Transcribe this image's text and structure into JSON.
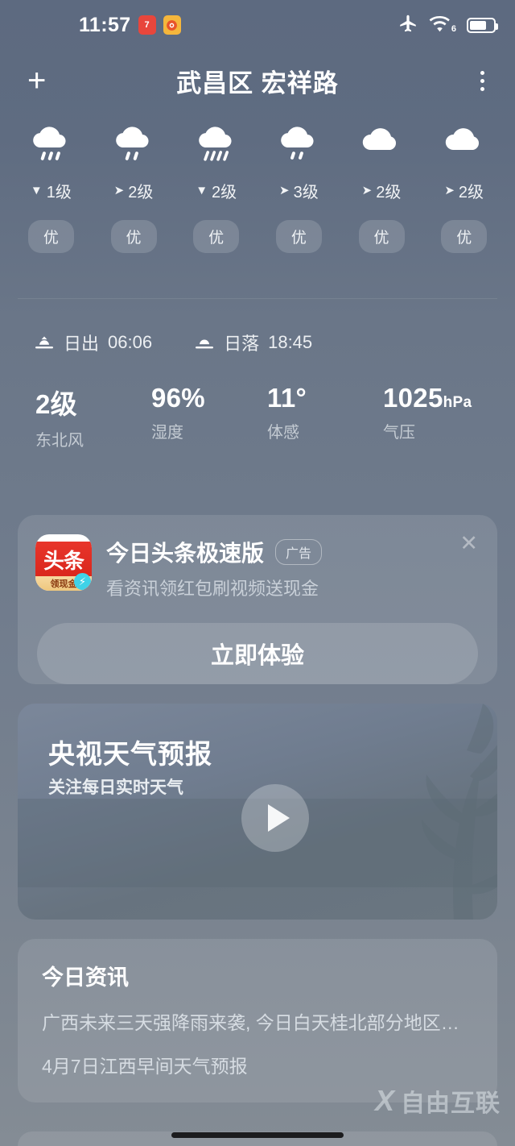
{
  "status_bar": {
    "time": "11:57",
    "badges": [
      {
        "name": "notification-badge-red",
        "glyph": "7"
      },
      {
        "name": "weibo-badge",
        "glyph": "◉"
      }
    ],
    "airplane_icon": "airplane-mode-icon",
    "wifi_icon": "wifi-icon",
    "wifi_generation": "6",
    "battery_icon": "battery-icon"
  },
  "header": {
    "add_label": "+",
    "title": "武昌区 宏祥路",
    "menu_label": "more-options"
  },
  "hourly": [
    {
      "icon": "rain-cloud-icon",
      "wind_dir": "▼",
      "wind": "1级",
      "aqi": "优"
    },
    {
      "icon": "rain-cloud-icon",
      "wind_dir": "➤",
      "wind": "2级",
      "aqi": "优"
    },
    {
      "icon": "heavy-rain-cloud-icon",
      "wind_dir": "▼",
      "wind": "2级",
      "aqi": "优"
    },
    {
      "icon": "rain-cloud-icon",
      "wind_dir": "➤",
      "wind": "3级",
      "aqi": "优"
    },
    {
      "icon": "cloud-icon",
      "wind_dir": "➤",
      "wind": "2级",
      "aqi": "优"
    },
    {
      "icon": "cloud-icon",
      "wind_dir": "➤",
      "wind": "2级",
      "aqi": "优"
    }
  ],
  "sun": {
    "sunrise_label": "日出",
    "sunrise_time": "06:06",
    "sunset_label": "日落",
    "sunset_time": "18:45"
  },
  "metrics": [
    {
      "value": "2级",
      "unit": "",
      "label": "东北风"
    },
    {
      "value": "96%",
      "unit": "",
      "label": "湿度"
    },
    {
      "value": "11°",
      "unit": "",
      "label": "体感"
    },
    {
      "value": "1025",
      "unit": "hPa",
      "label": "气压"
    }
  ],
  "ad": {
    "logo_main": "头条",
    "logo_banner": "领现金",
    "logo_bolt": "⚡",
    "title": "今日头条极速版",
    "tag": "广告",
    "subtitle": "看资讯领红包刷视频送现金",
    "close_label": "✕",
    "cta": "立即体验"
  },
  "video": {
    "title": "央视天气预报",
    "subtitle": "关注每日实时天气",
    "play_label": "play-button"
  },
  "news": {
    "heading": "今日资讯",
    "items": [
      "广西未来三天强降雨来袭, 今日白天桂北部分地区…",
      "4月7日江西早间天气预报"
    ]
  },
  "watermark": {
    "mark": "X",
    "text": "自由互联"
  },
  "colors": {
    "bg_top": "#5d6a80",
    "bg_bottom": "#848c95",
    "accent_red": "#e8352b",
    "accent_gold": "#eec77d",
    "accent_cyan": "#3fd2e8"
  }
}
